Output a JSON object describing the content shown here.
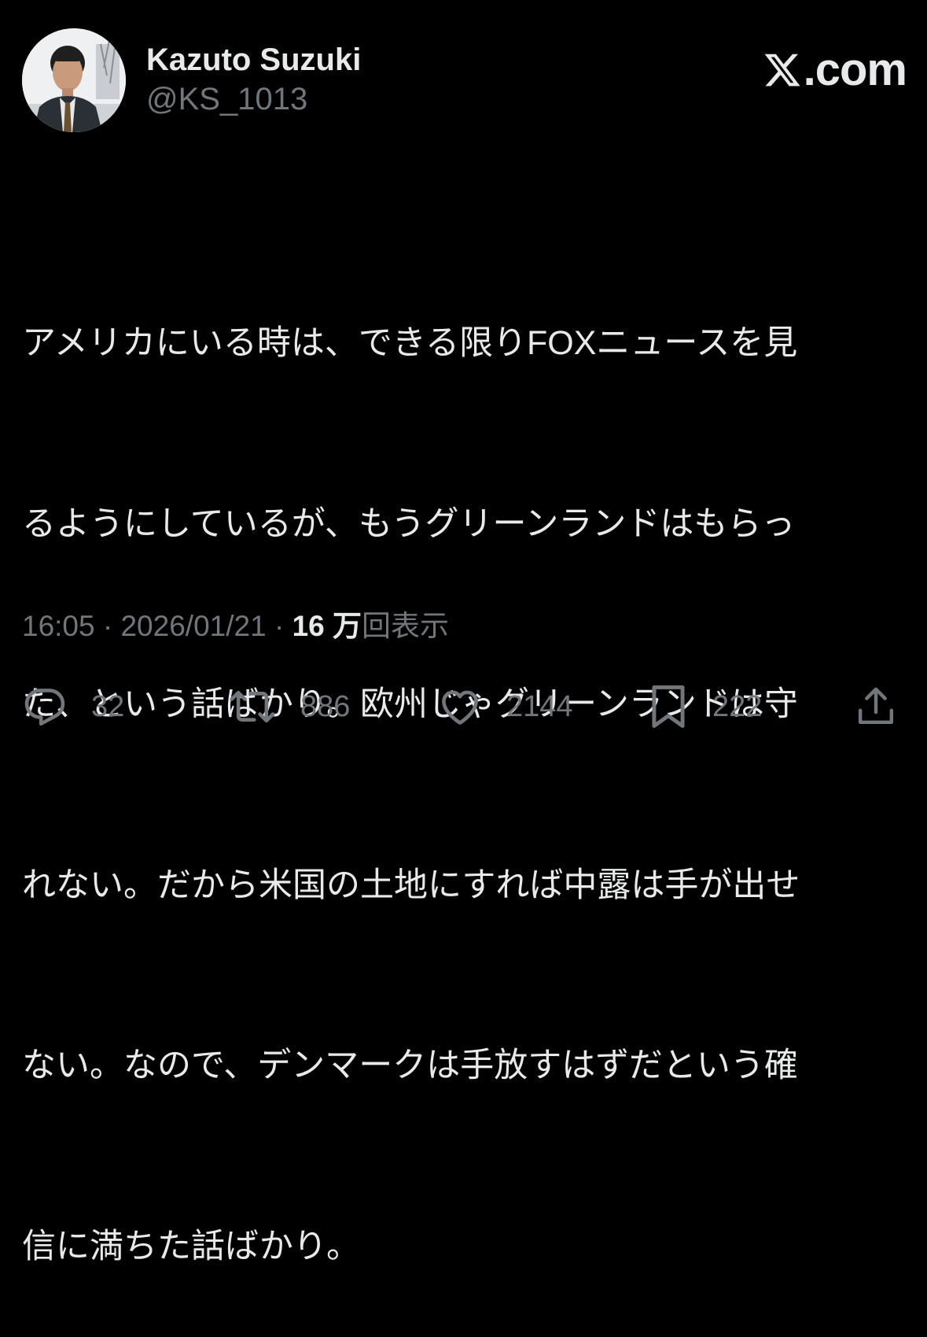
{
  "brand": {
    "logo_icon": "x-logo-icon",
    "domain": ".com"
  },
  "user": {
    "display_name": "Kazuto Suzuki",
    "handle": "@KS_1013",
    "avatar_icon": "profile-photo"
  },
  "tweet": {
    "lines": [
      "アメリカにいる時は、できる限りFOXニュースを見",
      "るようにしているが、もうグリーンランドはもらっ",
      "た、という話ばかり。欧州じゃグリーンランドは守",
      "れない。だから米国の土地にすれば中露は手が出せ",
      "ない。なので、デンマークは手放すはずだという確",
      "信に満ちた話ばかり。"
    ]
  },
  "meta": {
    "time": "16:05",
    "separator": " · ",
    "date": "2026/01/21",
    "views_count": "16 万",
    "views_label": "回表示"
  },
  "actions": {
    "reply": {
      "icon": "reply-icon",
      "count": "32"
    },
    "repost": {
      "icon": "repost-icon",
      "count": "886"
    },
    "like": {
      "icon": "heart-icon",
      "count": "2144"
    },
    "bookmark": {
      "icon": "bookmark-icon",
      "count": "222"
    },
    "share": {
      "icon": "share-icon"
    }
  },
  "colors": {
    "background": "#000000",
    "primary_text": "#e7e9ea",
    "secondary_text": "#71767b"
  }
}
